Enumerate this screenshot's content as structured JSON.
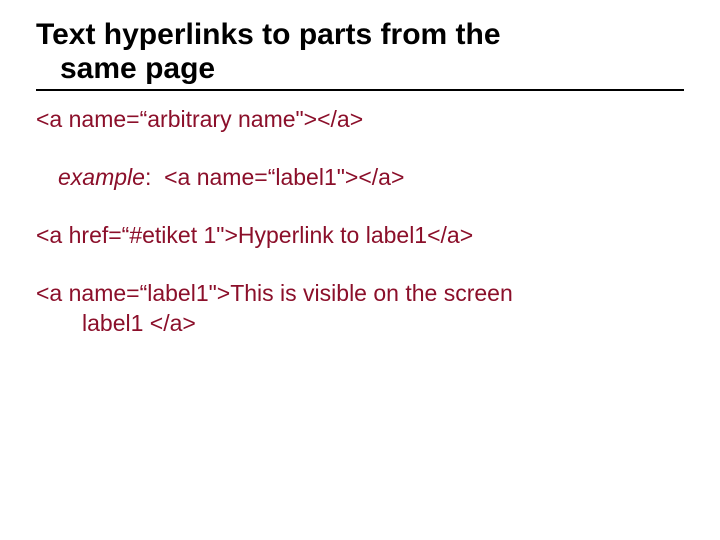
{
  "title": {
    "line1": "Text hyperlinks to parts from the",
    "line2": "same page"
  },
  "line1": "<a name=“arbitrary name\"></a>",
  "example_label": "example",
  "example_code": "<a name=“label1\"></a>",
  "line3": "<a href=“#etiket 1\">Hyperlink to label1</a>",
  "line4a": "<a name=“label1\">This is visible on the screen",
  "line4b": "label1 </a>"
}
